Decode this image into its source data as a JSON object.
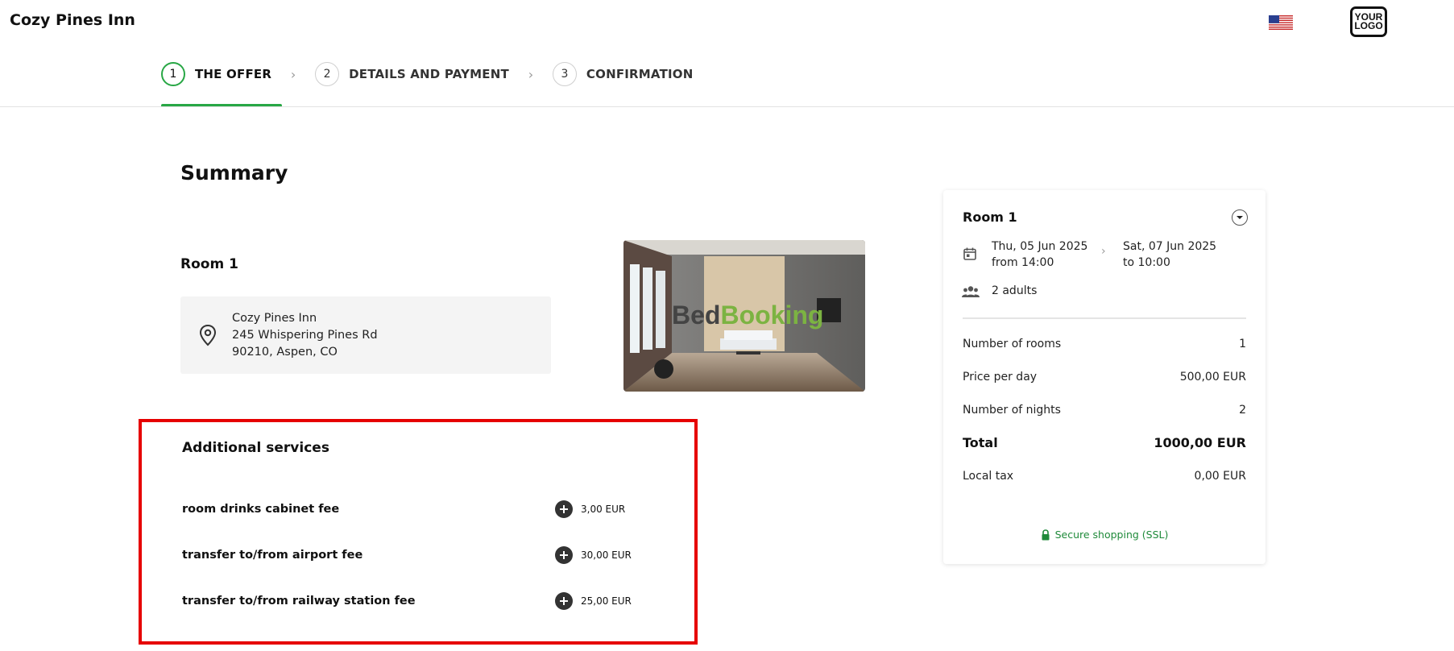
{
  "header": {
    "hotel_name": "Cozy Pines Inn",
    "language_flag": "us-flag-icon",
    "logo_text": "YOUR LOGO"
  },
  "stepper": {
    "steps": [
      {
        "number": "1",
        "label": "THE OFFER",
        "active": true
      },
      {
        "number": "2",
        "label": "DETAILS AND PAYMENT",
        "active": false
      },
      {
        "number": "3",
        "label": "CONFIRMATION",
        "active": false
      }
    ],
    "separator_icon": "chevron-right-icon"
  },
  "summary": {
    "title": "Summary",
    "room_title": "Room 1",
    "address": {
      "name": "Cozy Pines Inn",
      "street": "245 Whispering Pines Rd",
      "city": "90210, Aspen, CO"
    },
    "image_watermark": {
      "part1": "Bed",
      "part2": "Booking"
    }
  },
  "additional_services": {
    "title": "Additional services",
    "items": [
      {
        "name": "room drinks cabinet fee",
        "price": "3,00 EUR"
      },
      {
        "name": "transfer to/from airport fee",
        "price": "30,00 EUR"
      },
      {
        "name": "transfer to/from railway station fee",
        "price": "25,00 EUR"
      }
    ]
  },
  "booking_card": {
    "room_title": "Room 1",
    "checkin_date": "Thu, 05 Jun 2025",
    "checkin_time": "from 14:00",
    "checkout_date": "Sat, 07 Jun 2025",
    "checkout_time": "to 10:00",
    "guests": "2 adults",
    "rows": [
      {
        "label": "Number of rooms",
        "value": "1"
      },
      {
        "label": "Price per day",
        "value": "500,00 EUR"
      },
      {
        "label": "Number of nights",
        "value": "2"
      }
    ],
    "total": {
      "label": "Total",
      "value": "1000,00 EUR"
    },
    "local_tax": {
      "label": "Local tax",
      "value": "0,00 EUR"
    },
    "ssl_text": "Secure shopping (SSL)"
  },
  "colors": {
    "accent_green": "#28a745",
    "highlight_red": "#e60000",
    "ssl_green": "#1f8a3a"
  }
}
